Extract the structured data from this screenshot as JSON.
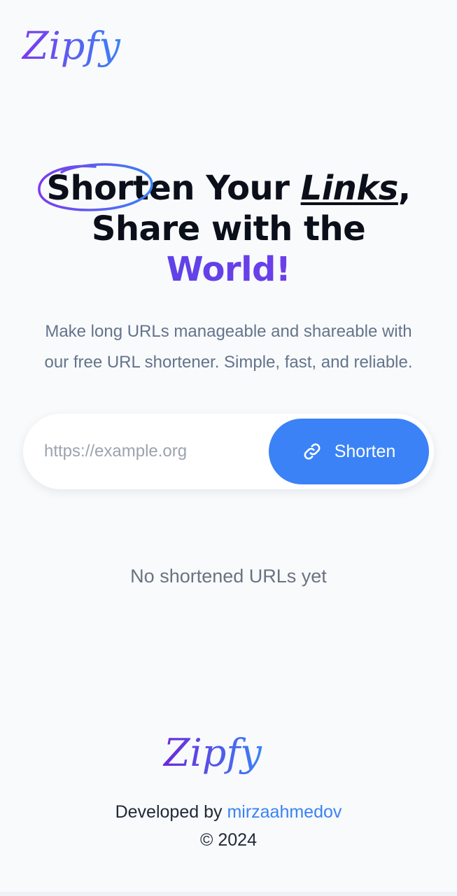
{
  "header": {
    "logo_text": "Zipfy"
  },
  "hero": {
    "circled_word": "Short",
    "line1_rest": "en Your ",
    "line1_links": "Links",
    "line1_comma": ",",
    "line2": "Share with the",
    "line3": "World!"
  },
  "subtitle": {
    "line1": "Make long URLs manageable and shareable with",
    "line2": "our free URL shortener. Simple, fast, and reliable."
  },
  "form": {
    "input_placeholder": "https://example.org",
    "input_value": "",
    "button_label": "Shorten",
    "button_icon": "link-icon"
  },
  "results": {
    "empty_message": "No shortened URLs yet"
  },
  "footer": {
    "logo_text": "Zipfy",
    "developed_by": "Developed by",
    "developer_link": "mirzaahmedov",
    "copyright": "© 2024"
  },
  "colors": {
    "background": "#f8fafc",
    "accent_blue": "#3b82f6",
    "accent_purple": "#6d28d9",
    "logo_gradient_start": "#7c3aed",
    "logo_gradient_end": "#3b82f6"
  }
}
